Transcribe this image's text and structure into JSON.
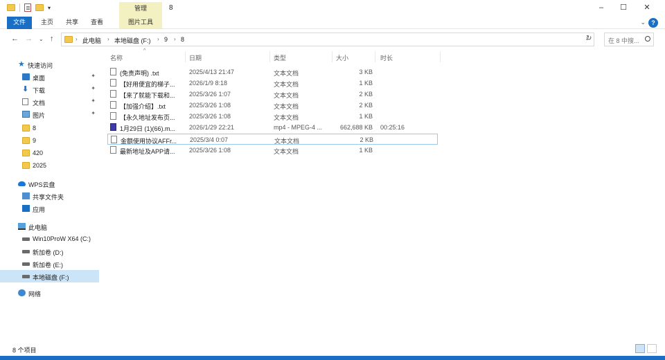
{
  "window": {
    "title": "8",
    "manage_tab": "管理",
    "controls": {
      "minimize": "–",
      "maximize": "☐",
      "close": "✕"
    }
  },
  "ribbon": {
    "tabs": [
      "文件",
      "主页",
      "共享",
      "查看",
      "图片工具"
    ],
    "help": "?"
  },
  "address": {
    "crumbs": [
      "此电脑",
      "本地磁盘 (F:)",
      "9",
      "8"
    ],
    "search_placeholder": "在 8 中搜..."
  },
  "sidebar": {
    "quick_access": "快速访问",
    "quick_items": [
      {
        "label": "桌面",
        "pinned": true
      },
      {
        "label": "下载",
        "pinned": true
      },
      {
        "label": "文档",
        "pinned": true
      },
      {
        "label": "图片",
        "pinned": true
      },
      {
        "label": "8"
      },
      {
        "label": "9"
      },
      {
        "label": "420"
      },
      {
        "label": "2025"
      }
    ],
    "wps": "WPS云盘",
    "shared": "共享文件夹",
    "apps": "应用",
    "this_pc": "此电脑",
    "drives": [
      "Win10ProW X64 (C:)",
      "新加卷 (D:)",
      "新加卷 (E:)",
      "本地磁盘 (F:)"
    ],
    "network": "网络"
  },
  "columns": {
    "name": "名称",
    "date": "日期",
    "type": "类型",
    "size": "大小",
    "duration": "时长"
  },
  "files": [
    {
      "name": "(免责声明) .txt",
      "date": "2025/4/13 21:47",
      "type": "文本文档",
      "size": "3 KB",
      "duration": ""
    },
    {
      "name": "【好用便宜的梯子...",
      "date": "2026/1/9 8:18",
      "type": "文本文档",
      "size": "1 KB",
      "duration": ""
    },
    {
      "name": "【来了就能下载和...",
      "date": "2025/3/26 1:07",
      "type": "文本文档",
      "size": "2 KB",
      "duration": ""
    },
    {
      "name": "【加强介绍】.txt",
      "date": "2025/3/26 1:08",
      "type": "文本文档",
      "size": "2 KB",
      "duration": ""
    },
    {
      "name": "【永久地址发布页...",
      "date": "2025/3/26 1:08",
      "type": "文本文档",
      "size": "1 KB",
      "duration": ""
    },
    {
      "name": "1月29日 (1)(66).m...",
      "date": "2026/1/29 22:21",
      "type": "mp4 - MPEG-4 ...",
      "size": "662,688 KB",
      "duration": "00:25:16"
    },
    {
      "name": "金额使用协议AFFr...",
      "date": "2025/3/4 0:07",
      "type": "文本文档",
      "size": "2 KB",
      "duration": ""
    },
    {
      "name": "最新地址及APP请...",
      "date": "2025/3/26 1:08",
      "type": "文本文档",
      "size": "1 KB",
      "duration": ""
    }
  ],
  "status": {
    "count": "8 个项目"
  }
}
